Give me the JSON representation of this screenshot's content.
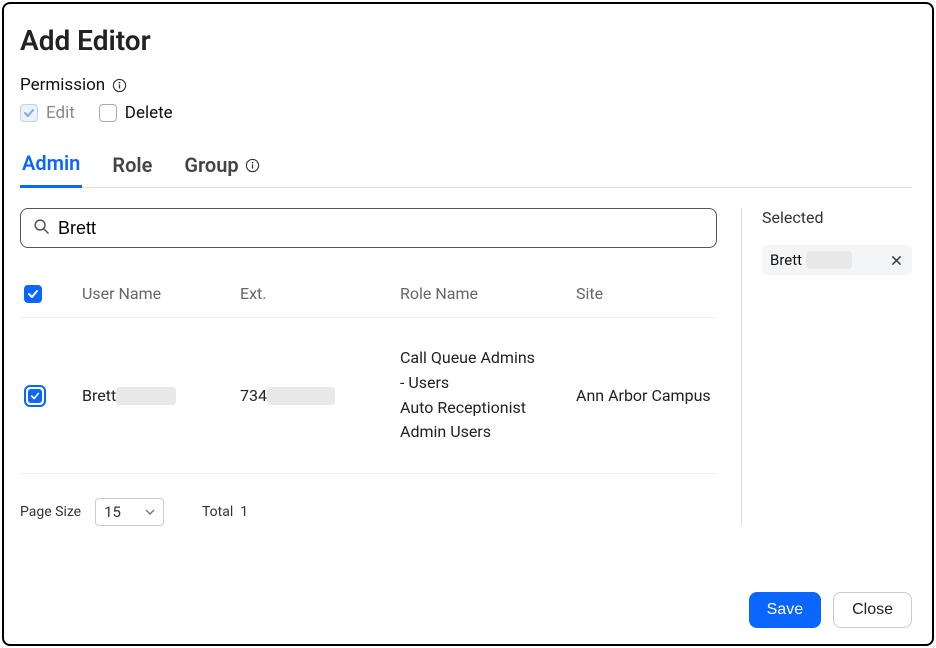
{
  "title": "Add Editor",
  "permission": {
    "label": "Permission",
    "edit_label": "Edit",
    "delete_label": "Delete"
  },
  "tabs": {
    "admin": "Admin",
    "role": "Role",
    "group": "Group"
  },
  "search": {
    "value": "Brett"
  },
  "columns": {
    "username": "User Name",
    "ext": "Ext.",
    "role": "Role Name",
    "site": "Site"
  },
  "rows": [
    {
      "checked": true,
      "username_prefix": "Brett",
      "ext_prefix": "734",
      "role_lines": [
        "Call Queue Admins",
        "- Users",
        "Auto Receptionist",
        "Admin Users"
      ],
      "site": "Ann Arbor Campus"
    }
  ],
  "pager": {
    "page_size_label": "Page Size",
    "page_size_value": "15",
    "total_label": "Total",
    "total_value": "1"
  },
  "selected": {
    "title": "Selected",
    "items": [
      {
        "label_prefix": "Brett"
      }
    ]
  },
  "footer": {
    "save": "Save",
    "close": "Close"
  }
}
